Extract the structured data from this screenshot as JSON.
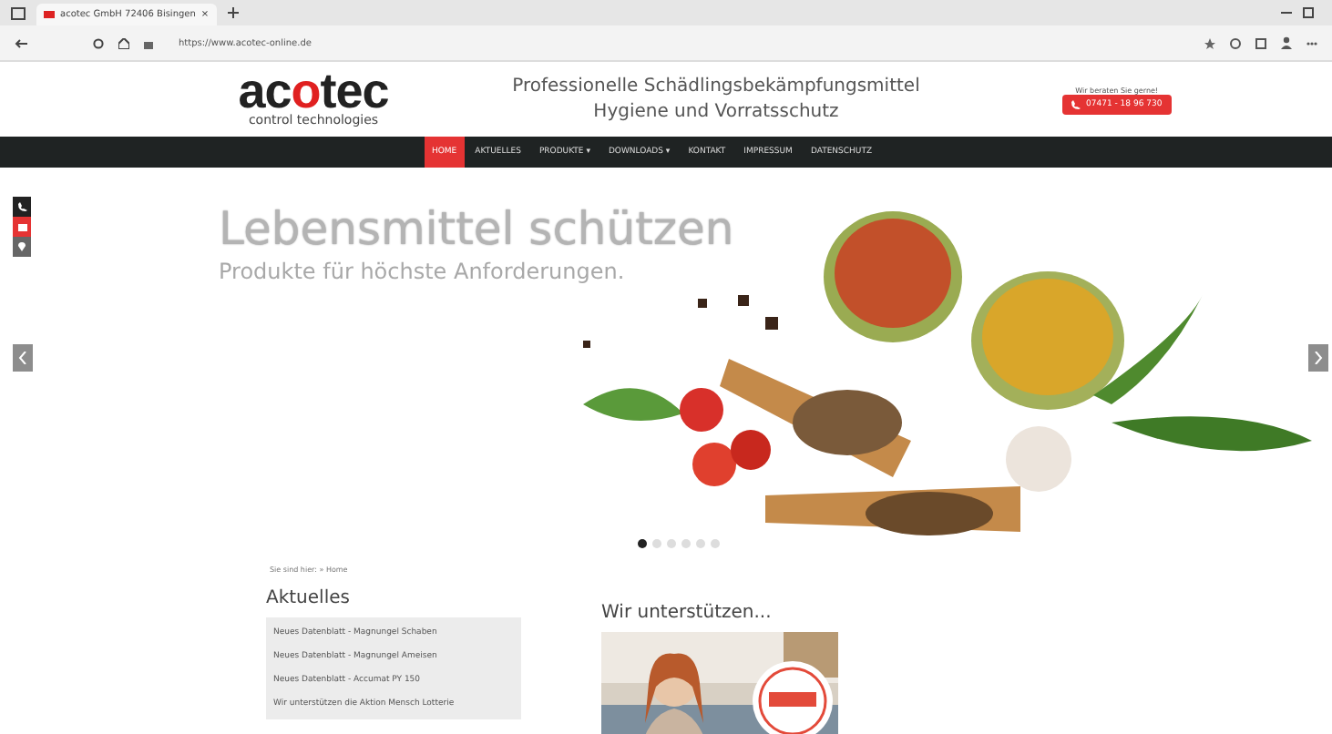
{
  "browser": {
    "tab_title": "acotec GmbH 72406 Bisingen",
    "url": "https://www.acotec-online.de",
    "tab_close": "×"
  },
  "header": {
    "logo_main": "acotec",
    "logo_sub": "control technologies",
    "tagline": [
      "Professionelle Schädlingsbekämpfungsmittel",
      "Hygiene und Vorratsschutz"
    ],
    "phone_hint": "Wir beraten Sie gerne!",
    "phone": "07471 - 18 96 730"
  },
  "nav": [
    {
      "label": "HOME",
      "selected": true
    },
    {
      "label": "AKTUELLES",
      "selected": false
    },
    {
      "label": "PRODUKTE ▾",
      "selected": false
    },
    {
      "label": "DOWNLOADS ▾",
      "selected": false
    },
    {
      "label": "KONTAKT",
      "selected": false
    },
    {
      "label": "IMPRESSUM",
      "selected": false
    },
    {
      "label": "DATENSCHUTZ",
      "selected": false
    }
  ],
  "hero": {
    "title": "Lebensmittel schützen",
    "subtitle": "Produkte für höchste Anforderungen.",
    "slides": [
      {
        "selected": true
      },
      {
        "selected": false
      },
      {
        "selected": false
      },
      {
        "selected": false
      },
      {
        "selected": false
      },
      {
        "selected": false
      }
    ]
  },
  "breadcrumb": "Sie sind hier: » Home",
  "news": {
    "title": "Aktuelles",
    "items": [
      "Neues Datenblatt - Magnungel Schaben",
      "Neues Datenblatt - Magnungel Ameisen",
      "Neues Datenblatt - Accumat PY 150",
      "Wir unterstützen die Aktion Mensch Lotterie"
    ]
  },
  "support": {
    "title": "Wir unterstützen..."
  }
}
